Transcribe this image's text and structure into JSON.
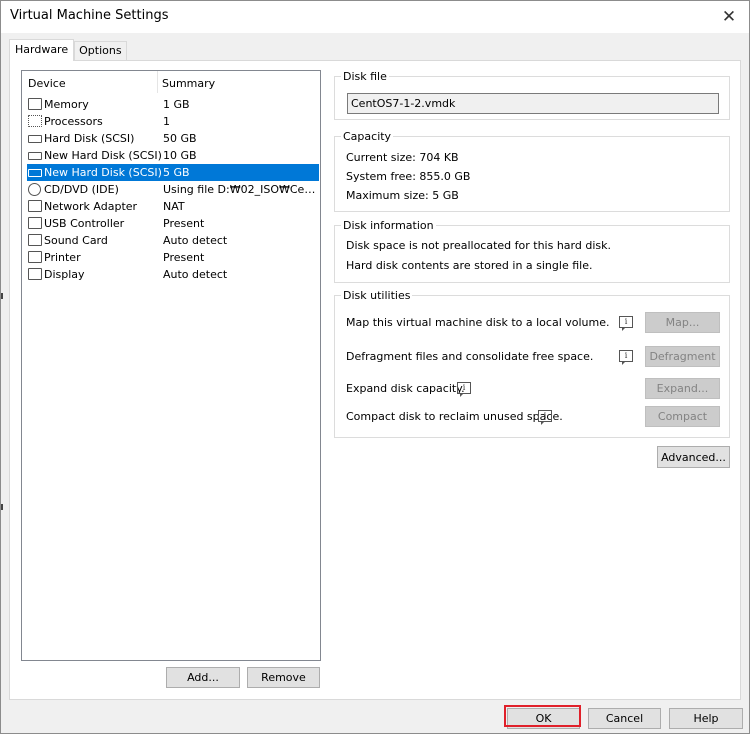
{
  "window": {
    "title": "Virtual Machine Settings",
    "close_glyph": "✕"
  },
  "tabs": [
    {
      "label": "Hardware",
      "active": true
    },
    {
      "label": "Options",
      "active": false
    }
  ],
  "device_list": {
    "columns": {
      "device": "Device",
      "summary": "Summary"
    },
    "rows": [
      {
        "name": "Memory",
        "summary": "1 GB",
        "icon": "memory-icon"
      },
      {
        "name": "Processors",
        "summary": "1",
        "icon": "processor-icon"
      },
      {
        "name": "Hard Disk (SCSI)",
        "summary": "50 GB",
        "icon": "hard-disk-icon"
      },
      {
        "name": "New Hard Disk (SCSI)",
        "summary": "10 GB",
        "icon": "hard-disk-icon"
      },
      {
        "name": "New Hard Disk (SCSI)",
        "summary": "5 GB",
        "icon": "hard-disk-icon",
        "selected": true
      },
      {
        "name": "CD/DVD (IDE)",
        "summary": "Using file D:₩02_ISO₩Cent...",
        "icon": "cd-dvd-icon"
      },
      {
        "name": "Network Adapter",
        "summary": "NAT",
        "icon": "network-adapter-icon"
      },
      {
        "name": "USB Controller",
        "summary": "Present",
        "icon": "usb-icon"
      },
      {
        "name": "Sound Card",
        "summary": "Auto detect",
        "icon": "speaker-icon"
      },
      {
        "name": "Printer",
        "summary": "Present",
        "icon": "printer-icon"
      },
      {
        "name": "Display",
        "summary": "Auto detect",
        "icon": "monitor-icon"
      }
    ],
    "add_label": "Add...",
    "remove_label": "Remove"
  },
  "disk_file": {
    "title": "Disk file",
    "value": "CentOS7-1-2.vmdk"
  },
  "capacity": {
    "title": "Capacity",
    "current": "Current size:  704 KB",
    "system_free": "System free:  855.0 GB",
    "maximum": "Maximum size:  5 GB"
  },
  "disk_information": {
    "title": "Disk information",
    "line1": "Disk space is not preallocated for this hard disk.",
    "line2": "Hard disk contents are stored in a single file."
  },
  "disk_utilities": {
    "title": "Disk utilities",
    "map_text": "Map this virtual machine disk to a local volume.",
    "map_label": "Map...",
    "defrag_text": "Defragment files and consolidate free space.",
    "defrag_label": "Defragment",
    "expand_text": "Expand disk capacity.",
    "expand_label": "Expand...",
    "compact_text": "Compact disk to reclaim unused space.",
    "compact_label": "Compact",
    "info_glyph": "i"
  },
  "advanced_label": "Advanced...",
  "footer": {
    "ok_label": "OK",
    "cancel_label": "Cancel",
    "help_label": "Help"
  },
  "colors": {
    "selection": "#0078d7",
    "highlight_box": "#e0202a"
  }
}
